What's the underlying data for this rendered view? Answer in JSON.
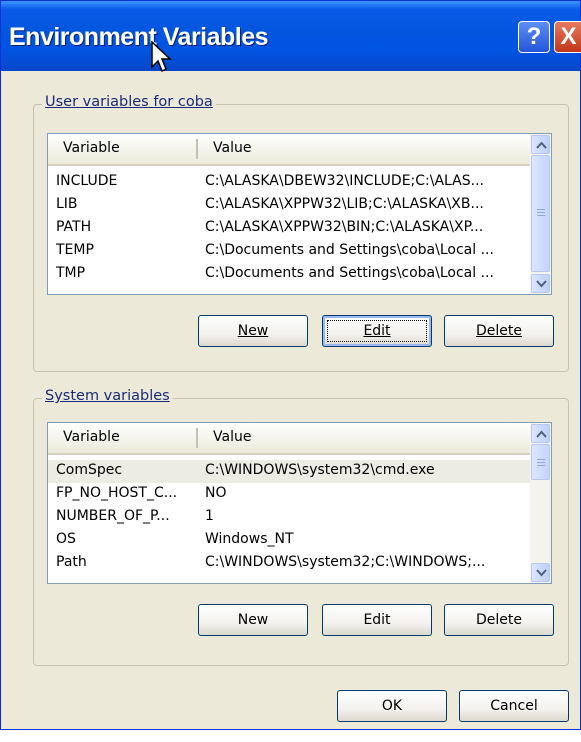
{
  "window": {
    "title": "Environment Variables",
    "help_glyph": "?",
    "close_glyph": "X"
  },
  "user_vars": {
    "group_label": "User variables for coba",
    "col_variable": "Variable",
    "col_value": "Value",
    "rows": [
      {
        "name": "INCLUDE",
        "value": "C:\\ALASKA\\DBEW32\\INCLUDE;C:\\ALAS..."
      },
      {
        "name": "LIB",
        "value": "C:\\ALASKA\\XPPW32\\LIB;C:\\ALASKA\\XB..."
      },
      {
        "name": "PATH",
        "value": "C:\\ALASKA\\XPPW32\\BIN;C:\\ALASKA\\XP..."
      },
      {
        "name": "TEMP",
        "value": "C:\\Documents and Settings\\coba\\Local ..."
      },
      {
        "name": "TMP",
        "value": "C:\\Documents and Settings\\coba\\Local ..."
      }
    ],
    "new_label": "New",
    "edit_label": "Edit",
    "delete_label": "Delete"
  },
  "system_vars": {
    "group_label": "System variables",
    "col_variable": "Variable",
    "col_value": "Value",
    "rows": [
      {
        "name": "ComSpec",
        "value": "C:\\WINDOWS\\system32\\cmd.exe"
      },
      {
        "name": "FP_NO_HOST_C...",
        "value": "NO"
      },
      {
        "name": "NUMBER_OF_P...",
        "value": "1"
      },
      {
        "name": "OS",
        "value": "Windows_NT"
      },
      {
        "name": "Path",
        "value": "C:\\WINDOWS\\system32;C:\\WINDOWS;..."
      }
    ],
    "new_label": "New",
    "edit_label": "Edit",
    "delete_label": "Delete"
  },
  "dialog": {
    "ok_label": "OK",
    "cancel_label": "Cancel"
  },
  "colors": {
    "titlebar": "#0054E3",
    "dialog_bg": "#ECE9D8",
    "close_red": "#C2361A"
  }
}
